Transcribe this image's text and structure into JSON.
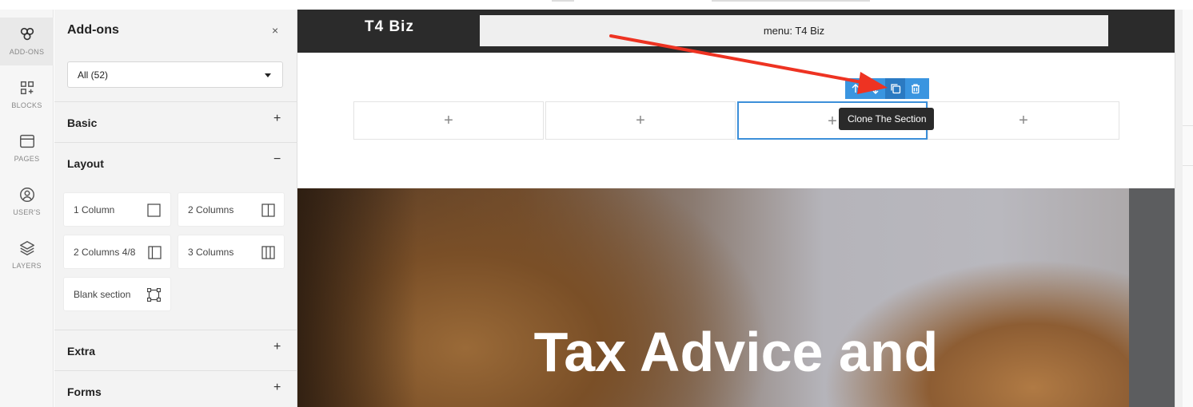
{
  "rail": {
    "items": [
      {
        "label": "ADD-ONS",
        "icon": "addons-icon"
      },
      {
        "label": "BLOCKS",
        "icon": "blocks-icon"
      },
      {
        "label": "PAGES",
        "icon": "pages-icon"
      },
      {
        "label": "USER'S",
        "icon": "user-icon"
      },
      {
        "label": "LAYERS",
        "icon": "layers-icon"
      }
    ]
  },
  "panel": {
    "title": "Add-ons",
    "close": "×",
    "filter": {
      "value": "All (52)"
    },
    "categories": {
      "basic": {
        "name": "Basic",
        "toggle": "+"
      },
      "layout": {
        "name": "Layout",
        "toggle": "−"
      },
      "extra": {
        "name": "Extra",
        "toggle": "+"
      },
      "forms": {
        "name": "Forms",
        "toggle": "+"
      }
    },
    "layout_tiles": [
      {
        "label": "1 Column",
        "icon": "one-column-icon"
      },
      {
        "label": "2 Columns",
        "icon": "two-columns-icon"
      },
      {
        "label": "2 Columns 4/8",
        "icon": "two-columns-4-8-icon"
      },
      {
        "label": "3 Columns",
        "icon": "three-columns-icon"
      },
      {
        "label": "Blank section",
        "icon": "blank-section-icon"
      }
    ]
  },
  "canvas": {
    "logo": "T4 Biz",
    "menu": "menu: T4 Biz",
    "column_plus": "+",
    "tooltip": "Clone The Section",
    "hero_title": "Tax Advice and"
  },
  "colors": {
    "accent": "#3a95e0",
    "arrow": "#ee3322",
    "header": "#2b2b2b"
  }
}
